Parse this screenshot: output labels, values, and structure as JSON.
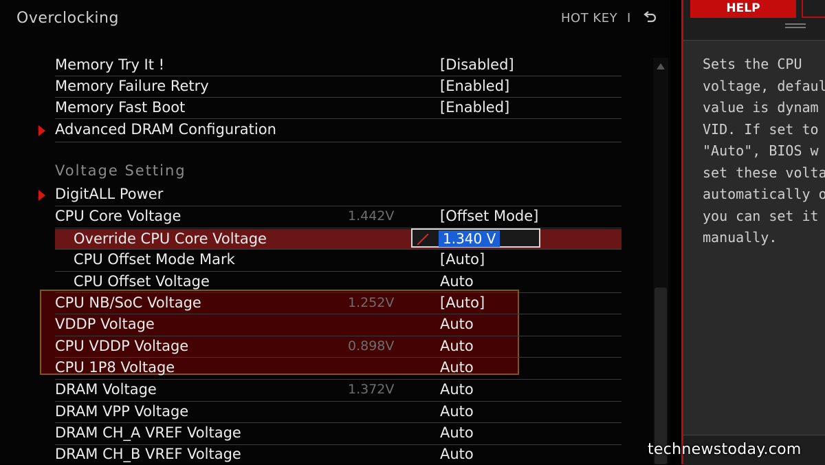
{
  "header": {
    "title": "Overclocking",
    "hotkey": "HOT KEY",
    "separator": "I"
  },
  "rows": [
    {
      "label": "Memory Try It !",
      "current": "",
      "value": "[Disabled]"
    },
    {
      "label": "Memory Failure Retry",
      "current": "",
      "value": "[Enabled]"
    },
    {
      "label": "Memory Fast Boot",
      "current": "",
      "value": "[Enabled]"
    },
    {
      "label": "Advanced DRAM Configuration",
      "current": "",
      "value": ""
    },
    {
      "label": "Voltage Setting",
      "current": "",
      "value": ""
    },
    {
      "label": "DigitALL Power",
      "current": "",
      "value": ""
    },
    {
      "label": "CPU Core Voltage",
      "current": "1.442V",
      "value": "[Offset Mode]"
    },
    {
      "label": "Override CPU Core Voltage",
      "current": "",
      "value": "1.340 V"
    },
    {
      "label": "CPU Offset Mode Mark",
      "current": "",
      "value": "[Auto]"
    },
    {
      "label": "CPU Offset Voltage",
      "current": "",
      "value": "Auto"
    },
    {
      "label": "CPU NB/SoC Voltage",
      "current": "1.252V",
      "value": "[Auto]"
    },
    {
      "label": "VDDP Voltage",
      "current": "",
      "value": "Auto"
    },
    {
      "label": "CPU VDDP Voltage",
      "current": "0.898V",
      "value": "Auto"
    },
    {
      "label": "CPU 1P8 Voltage",
      "current": "",
      "value": "Auto"
    },
    {
      "label": "DRAM Voltage",
      "current": "1.372V",
      "value": "Auto"
    },
    {
      "label": "DRAM VPP Voltage",
      "current": "",
      "value": "Auto"
    },
    {
      "label": "DRAM CH_A VREF Voltage",
      "current": "",
      "value": "Auto"
    },
    {
      "label": "DRAM CH_B VREF Voltage",
      "current": "",
      "value": "Auto"
    }
  ],
  "help": {
    "tab": "HELP",
    "text": "Sets the CPU\nvoltage, defaul\nvalue is dynam\nVID. If set to\n\"Auto\", BIOS w\nset these volta\nautomatically o\nyou can set it\nmanually."
  },
  "watermark": "technewstoday.com",
  "colors": {
    "accent": "#d51414",
    "selected_row": "#6a1616",
    "edit_highlight": "#1b5fd6"
  }
}
